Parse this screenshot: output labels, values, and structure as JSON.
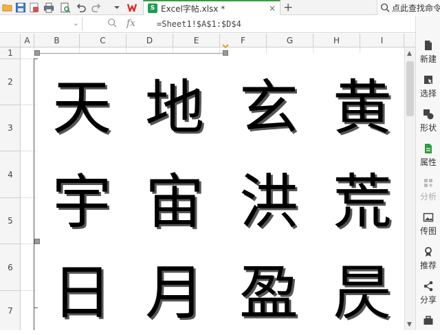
{
  "toolbar": {
    "icons": [
      "folder-open-icon",
      "save-icon",
      "export-pdf-icon",
      "print-icon",
      "print-preview-icon",
      "undo-icon",
      "redo-icon",
      "dropdown-icon",
      "wps-logo-icon"
    ],
    "search_placeholder": "点此查找命令"
  },
  "tab": {
    "title": "Excel字帖.xlsx *",
    "close_label": "×",
    "new_tab_label": "+"
  },
  "formula_bar": {
    "name_box_value": "",
    "fx_label": "fx",
    "formula": "=Sheet1!$A$1:$D$4"
  },
  "sheet": {
    "columns": [
      "A",
      "B",
      "C",
      "D",
      "E",
      "F",
      "G",
      "H",
      "I"
    ],
    "rows": [
      "1",
      "2",
      "3",
      "4",
      "5",
      "6",
      "7"
    ]
  },
  "picture": {
    "characters": [
      "天",
      "地",
      "玄",
      "黄",
      "宇",
      "宙",
      "洪",
      "荒",
      "日",
      "月",
      "盈",
      "昃"
    ]
  },
  "right_panel": {
    "items": [
      {
        "icon": "new-icon",
        "label": "新建",
        "enabled": true
      },
      {
        "icon": "select-icon",
        "label": "选择",
        "enabled": true
      },
      {
        "icon": "shapes-icon",
        "label": "形状",
        "enabled": true
      },
      {
        "icon": "properties-icon",
        "label": "属性",
        "enabled": true
      },
      {
        "icon": "analysis-icon",
        "label": "分析",
        "enabled": false
      },
      {
        "icon": "send-image-icon",
        "label": "传图",
        "enabled": true
      },
      {
        "icon": "recommend-icon",
        "label": "推荐",
        "enabled": true
      },
      {
        "icon": "share-icon",
        "label": "分享",
        "enabled": true
      }
    ]
  },
  "colors": {
    "accent_green": "#3c9a3c",
    "wps_red": "#e02d2d",
    "excel_green": "#1f9d55"
  }
}
